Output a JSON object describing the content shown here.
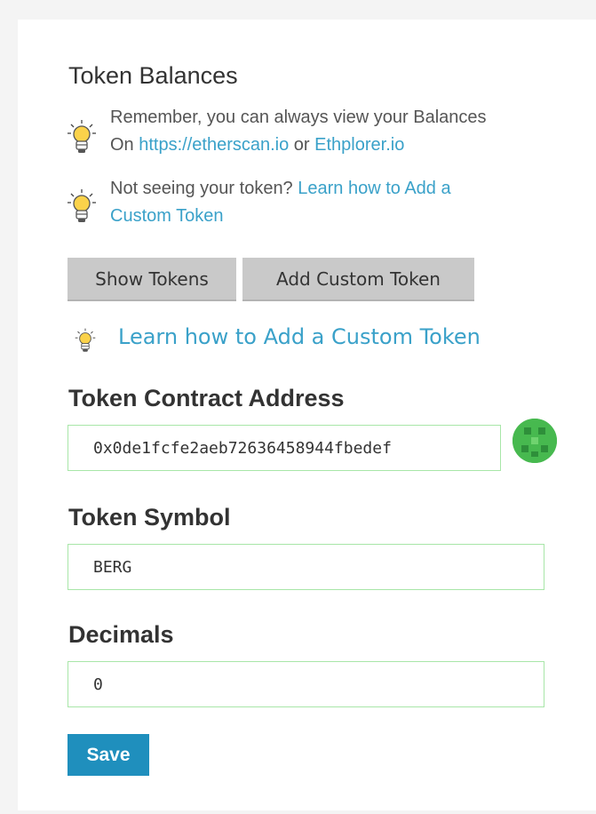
{
  "title": "Token Balances",
  "notes": [
    {
      "text1": "Remember, you can always view your Balances",
      "text2_pre": "On ",
      "link1": "https://etherscan.io",
      "mid": " or ",
      "link2": "Ethplorer.io"
    },
    {
      "text1": "Not seeing your token? ",
      "link1": "Learn how to Add a",
      "link2": "Custom Token"
    }
  ],
  "buttons": {
    "show_tokens": "Show Tokens",
    "add_custom_token": "Add Custom Token",
    "save": "Save"
  },
  "learn_link": "Learn how to Add a Custom Token",
  "form": {
    "address_label": "Token Contract Address",
    "address_value": "0x0de1fcfe2aeb72636458944fbedef",
    "symbol_label": "Token Symbol",
    "symbol_value": "BERG",
    "decimals_label": "Decimals",
    "decimals_value": "0"
  },
  "icons": {
    "tip": "lightbulb-icon",
    "identicon": "address-identicon"
  },
  "colors": {
    "link": "#3aa1c9",
    "save_button": "#1f8fbd",
    "field_border": "#a8e6a8",
    "grey_button": "#c9c9c9",
    "identicon": "#47b94f"
  }
}
